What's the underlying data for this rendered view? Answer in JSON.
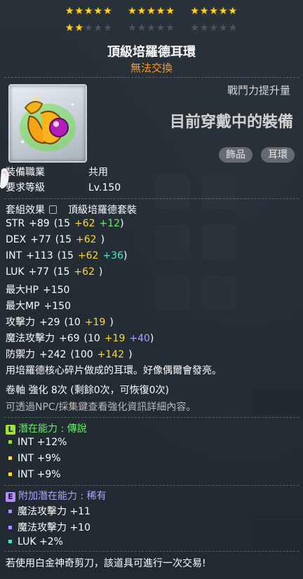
{
  "stars": {
    "row1": [
      "★★★★★",
      "★★★★★",
      "★★★★★"
    ],
    "row2_on": "★★",
    "row2_off_a": "★★★",
    "row2_off_b": "★★★★★",
    "row2_off_c": "★★★★★"
  },
  "item": {
    "name": "頂級培羅德耳環",
    "trade": "無法交換",
    "power_label": "戰鬥力提升量",
    "equipped_text": "目前穿戴中的裝備",
    "tags": [
      "飾品",
      "耳環"
    ],
    "icon": "earring-gem-icon"
  },
  "requirements": {
    "job_label": "裝備職業",
    "job_value": "共用",
    "level_label": "要求等級",
    "level_value": "Lv.150"
  },
  "set": {
    "label": "套組效果",
    "name": "頂級培羅德套裝"
  },
  "stats": [
    {
      "k": "STR",
      "v": "+89",
      "p": "(15",
      "a": "+62",
      "b": "+12",
      "bc": "green",
      "e": ")"
    },
    {
      "k": "DEX",
      "v": "+77",
      "p": "(15",
      "a": "+62",
      "b": "",
      "bc": "",
      "e": ")"
    },
    {
      "k": "INT",
      "v": "+113",
      "p": "(15",
      "a": "+62",
      "b": "+36",
      "bc": "cyan",
      "e": ")"
    },
    {
      "k": "LUK",
      "v": "+77",
      "p": "(15",
      "a": "+62",
      "b": "",
      "bc": "",
      "e": ")"
    },
    {
      "k": "最大HP",
      "v": "+150",
      "p": "",
      "a": "",
      "b": "",
      "bc": "",
      "e": ""
    },
    {
      "k": "最大MP",
      "v": "+150",
      "p": "",
      "a": "",
      "b": "",
      "bc": "",
      "e": ""
    },
    {
      "k": "攻擊力",
      "v": "+29",
      "p": "(10",
      "a": "+19",
      "b": "",
      "bc": "",
      "e": ")"
    },
    {
      "k": "魔法攻擊力",
      "v": "+69",
      "p": "(10",
      "a": "+19",
      "b": "+40",
      "bc": "purple",
      "e": ")"
    },
    {
      "k": "防禦力",
      "v": "+242",
      "p": "(100",
      "a": "+142",
      "b": "",
      "bc": "",
      "e": ")"
    }
  ],
  "description": "用培羅德核心碎片做成的耳環。好像偶爾會發亮。",
  "scroll": "卷軸 強化 8次 (剩餘0次，可恢復0次)",
  "scroll_hint": "可透過NPC/採集鍵查看強化資訊詳細內容。",
  "potential": {
    "badge": "L",
    "label": "潛在能力",
    "sep": ":",
    "grade": "傳說",
    "lines": [
      "INT +12%",
      "INT +9%",
      "INT +9%"
    ],
    "color": "#9ee23c"
  },
  "bonus_potential": {
    "badge": "E",
    "label": "附加潛在能力",
    "sep": ":",
    "grade": "稀有",
    "lines": [
      "魔法攻擊力 +11",
      "魔法攻擊力 +10",
      "LUK +2%"
    ],
    "color": "#b58cff"
  },
  "footer": "若使用白金神奇剪刀，該道具可進行一次交易!"
}
